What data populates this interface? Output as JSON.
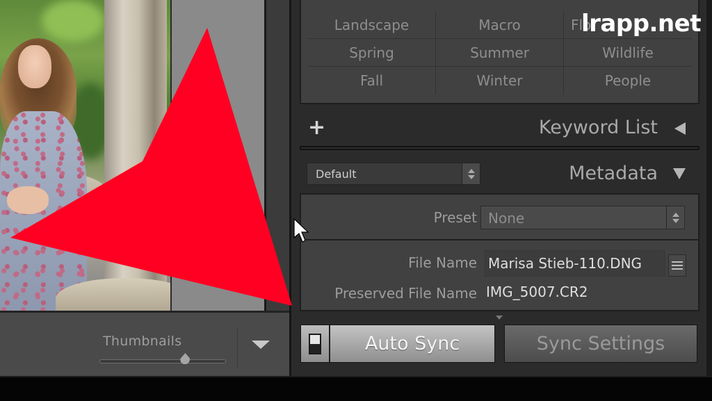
{
  "filmstrip_toolbar": {
    "thumbnails_label": "Thumbnails",
    "thumbnail_size_fraction": 0.68,
    "toggle_icon": "triangle-down-icon"
  },
  "keyword_set": {
    "keywords": [
      "Landscape",
      "Macro",
      "Flo",
      "Spring",
      "Summer",
      "Wildlife",
      "Fall",
      "Winter",
      "People"
    ]
  },
  "keyword_list": {
    "add_icon": "plus-icon",
    "title": "Keyword List",
    "toggle_icon": "triangle-left-icon"
  },
  "metadata": {
    "preset_dropdown_value": "Default",
    "title": "Metadata",
    "toggle_icon": "triangle-down-icon",
    "fields": {
      "preset_label": "Preset",
      "preset_value": "None",
      "file_name_label": "File Name",
      "file_name_value": "Marisa Stieb-110.DNG",
      "preserved_file_name_label": "Preserved File Name",
      "preserved_file_name_value": "IMG_5007.CR2"
    }
  },
  "sync": {
    "auto_sync_label": "Auto Sync",
    "sync_settings_label": "Sync Settings"
  },
  "overlay": {
    "watermark": "lrapp.net",
    "arrow_color": "#ff0022"
  }
}
